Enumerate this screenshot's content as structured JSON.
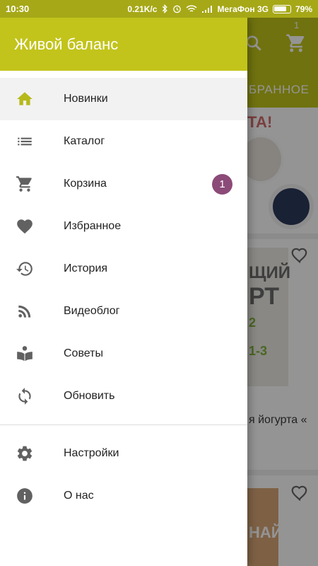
{
  "status_bar": {
    "time": "10:30",
    "speed": "0.21K/c",
    "carrier": "МегаФон 3G",
    "battery": "79%"
  },
  "background": {
    "tab_label": "БРАННОЕ",
    "cart_count": "1",
    "banner_text": "ТА!",
    "product1_title": "я йогурта «",
    "product1_pack_text1": "ЩИЙ",
    "product1_pack_text2": "РТ",
    "product1_pack_text3": "2",
    "product1_pack_text4": "1-3",
    "product2_pack_text": "НАЙ"
  },
  "drawer": {
    "title": "Живой баланс",
    "accent_color": "#c2c41b",
    "badge_color": "#8c4a78",
    "items": [
      {
        "label": "Новинки",
        "icon": "home-icon",
        "active": true
      },
      {
        "label": "Каталог",
        "icon": "list-icon"
      },
      {
        "label": "Корзина",
        "icon": "cart-icon",
        "badge": "1"
      },
      {
        "label": "Избранное",
        "icon": "heart-icon"
      },
      {
        "label": "История",
        "icon": "history-icon"
      },
      {
        "label": "Видеоблог",
        "icon": "rss-icon"
      },
      {
        "label": "Советы",
        "icon": "reader-icon"
      },
      {
        "label": "Обновить",
        "icon": "refresh-icon"
      }
    ],
    "secondary_items": [
      {
        "label": "Настройки",
        "icon": "settings-icon"
      },
      {
        "label": "О нас",
        "icon": "info-icon"
      }
    ]
  }
}
